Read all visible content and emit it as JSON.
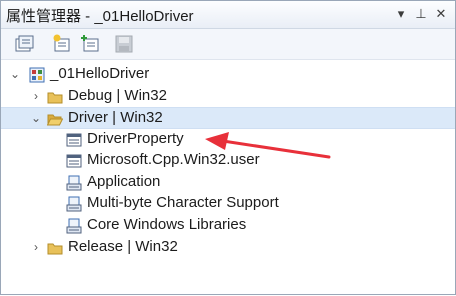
{
  "panel": {
    "title": "属性管理器 - _01HelloDriver",
    "dropdown_glyph": "▾",
    "pin_glyph": "⊥",
    "close_glyph": "✕"
  },
  "toolbar": {
    "tools": [
      {
        "icon": "existing-property-sheet-icon",
        "enabled": true
      },
      {
        "icon": "new-property-sheet-icon",
        "enabled": true
      },
      {
        "icon": "add-property-sheet-icon",
        "enabled": true
      },
      {
        "icon": "save-icon",
        "enabled": false
      }
    ]
  },
  "tree": {
    "project": {
      "label": "_01HelloDriver",
      "expander": "⌄",
      "icon": "project-icon"
    },
    "configs": [
      {
        "label": "Debug | Win32",
        "expander": "›",
        "icon": "folder-icon",
        "expanded": false
      },
      {
        "label": "Driver | Win32",
        "expander": "⌄",
        "icon": "folder-open-icon",
        "expanded": true,
        "selected": true,
        "children": [
          {
            "label": "DriverProperty",
            "icon": "property-sheet-icon"
          },
          {
            "label": "Microsoft.Cpp.Win32.user",
            "icon": "property-sheet-icon"
          },
          {
            "label": "Application",
            "icon": "system-property-sheet-icon"
          },
          {
            "label": "Multi-byte Character Support",
            "icon": "system-property-sheet-icon"
          },
          {
            "label": "Core Windows Libraries",
            "icon": "system-property-sheet-icon"
          }
        ]
      },
      {
        "label": "Release | Win32",
        "expander": "›",
        "icon": "folder-icon",
        "expanded": false
      }
    ]
  },
  "colors": {
    "selection": "#dbe9f9",
    "annotation_arrow": "#e8303a",
    "folder": "#e8c15a"
  }
}
